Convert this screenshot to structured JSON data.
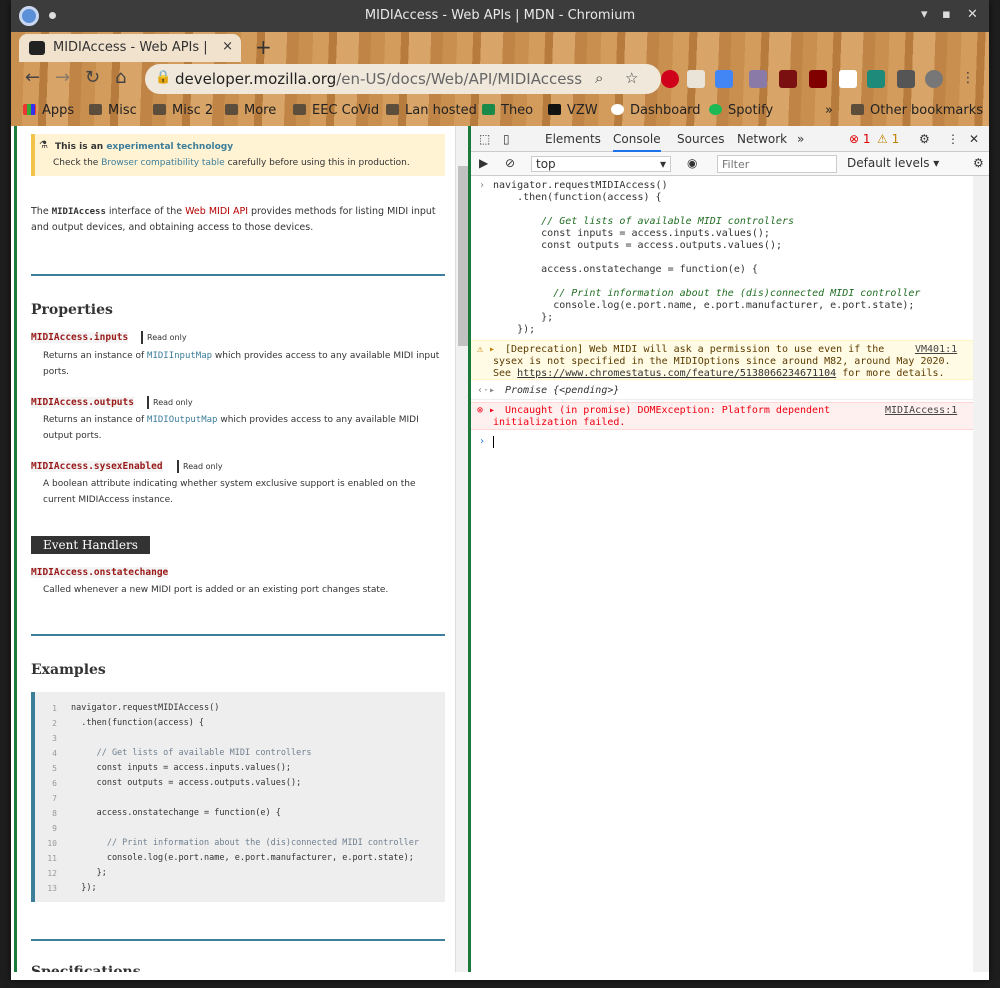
{
  "window": {
    "title": "MIDIAccess - Web APIs | MDN - Chromium",
    "controls": [
      "▾",
      "▪",
      "✕"
    ]
  },
  "tab": {
    "title": "MIDIAccess - Web APIs | MDN",
    "close": "×"
  },
  "new_tab": "+",
  "nav": {
    "back": "←",
    "forward": "→",
    "reload": "↻",
    "home": "⌂",
    "url_host": "developer.mozilla.org",
    "url_path": "/en-US/docs/Web/API/MIDIAccess"
  },
  "bookmarks": [
    {
      "label": "Apps"
    },
    {
      "label": "Misc"
    },
    {
      "label": "Misc 2"
    },
    {
      "label": "More"
    },
    {
      "label": "EEC CoVid"
    },
    {
      "label": "Lan hosted"
    },
    {
      "label": "Theo"
    },
    {
      "label": "VZW"
    },
    {
      "label": "Dashboard"
    },
    {
      "label": "Spotify"
    }
  ],
  "bookmarks_more": "»",
  "other_bookmarks": "Other bookmarks",
  "mdn": {
    "warn_title_prefix": "This is an ",
    "warn_title_link": "experimental technology",
    "warn_line2_a": "Check the ",
    "warn_line2_link": "Browser compatibility table",
    "warn_line2_b": " carefully before using this in production.",
    "intro_a": "The ",
    "intro_code": "MIDIAccess",
    "intro_b": " interface of the ",
    "intro_link": "Web MIDI API",
    "intro_c": " provides methods for listing MIDI input and output devices, and obtaining access to those devices.",
    "properties_heading": "Properties",
    "props": [
      {
        "name": "MIDIAccess.inputs",
        "badge": "Read only",
        "desc_a": "Returns an instance of ",
        "desc_code": "MIDIInputMap",
        "desc_b": " which provides access to any available MIDI input ports."
      },
      {
        "name": "MIDIAccess.outputs",
        "badge": "Read only",
        "desc_a": "Returns an instance of ",
        "desc_code": "MIDIOutputMap",
        "desc_b": " which provides access to any available MIDI output ports."
      },
      {
        "name": "MIDIAccess.sysexEnabled",
        "badge": "Read only",
        "desc_a": "A boolean attribute indicating whether system exclusive support is enabled on the current MIDIAccess instance.",
        "desc_code": "",
        "desc_b": ""
      }
    ],
    "event_handlers_heading": "Event Handlers",
    "event": {
      "name": "MIDIAccess.onstatechange",
      "desc": "Called whenever a new MIDI port is added or an existing port changes state."
    },
    "examples_heading": "Examples",
    "example_lines": [
      "navigator.requestMIDIAccess()",
      "  .then(function(access) {",
      "",
      "     // Get lists of available MIDI controllers",
      "     const inputs = access.inputs.values();",
      "     const outputs = access.outputs.values();",
      "",
      "     access.onstatechange = function(e) {",
      "",
      "       // Print information about the (dis)connected MIDI controller",
      "       console.log(e.port.name, e.port.manufacturer, e.port.state);",
      "     };",
      "  });"
    ],
    "next_heading": "Specifications"
  },
  "devtools": {
    "tabs": [
      "Elements",
      "Console",
      "Sources",
      "Network"
    ],
    "active_tab": "Console",
    "more": "»",
    "errors": "1",
    "warnings": "1",
    "context": "top",
    "filter_placeholder": "Filter",
    "levels": "Default levels ▾",
    "input_lines": [
      "navigator.requestMIDIAccess()",
      "    .then(function(access) {",
      "",
      "        // Get lists of available MIDI controllers",
      "        const inputs = access.inputs.values();",
      "        const outputs = access.outputs.values();",
      "",
      "        access.onstatechange = function(e) {",
      "",
      "          // Print information about the (dis)connected MIDI controller",
      "          console.log(e.port.name, e.port.manufacturer, e.port.state);",
      "        };",
      "    });"
    ],
    "warning": {
      "line1": "[Deprecation] Web MIDI will ask a permission to use even if the",
      "line2": "sysex is not specified in the MIDIOptions since around M82, around May 2020.",
      "line3_a": "See ",
      "line3_link": "https://www.chromestatus.com/feature/5138066234671104",
      "line3_b": " for more details.",
      "source": "VM401:1"
    },
    "promise": "Promise {<pending>}",
    "error": {
      "line1": "Uncaught (in promise) DOMException: Platform dependent",
      "line2": "initialization failed.",
      "source": "MIDIAccess:1"
    }
  }
}
